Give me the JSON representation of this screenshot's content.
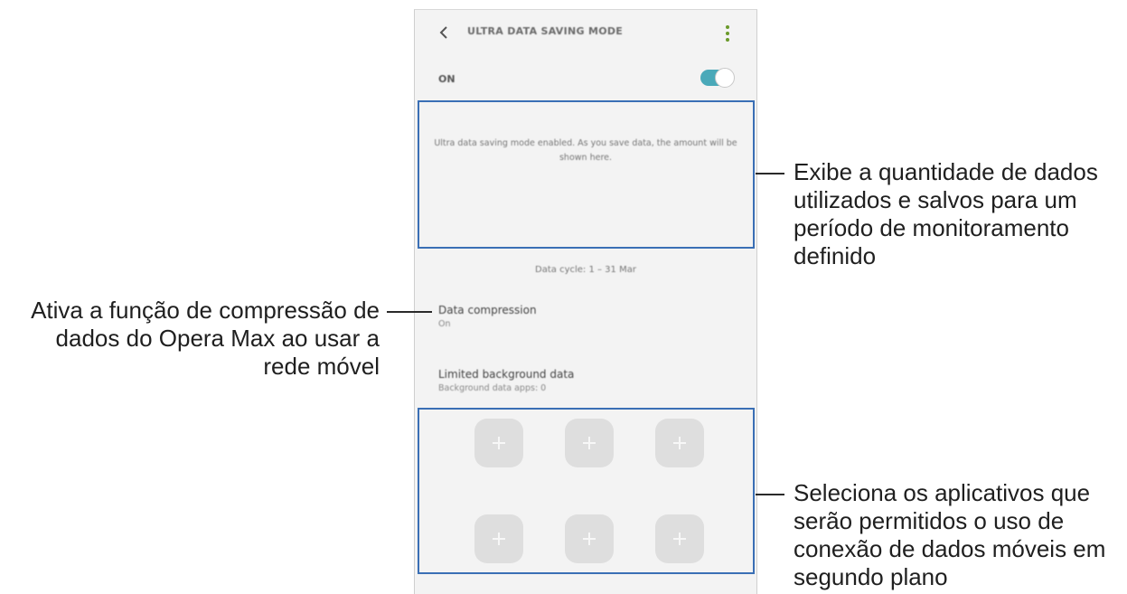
{
  "phone": {
    "title": "ULTRA DATA SAVING MODE",
    "on_label": "ON",
    "toggle_on": true,
    "accent_color": "#4aa9b9",
    "message": "Ultra data saving mode enabled. As you save data, the amount will be shown here.",
    "data_cycle": "Data cycle: 1 – 31 Mar",
    "settings": [
      {
        "title": "Data compression",
        "subtitle": "On"
      },
      {
        "title": "Limited background data",
        "subtitle": "Background data apps: 0"
      }
    ],
    "add_slots": [
      "add-icon",
      "add-icon",
      "add-icon",
      "add-icon",
      "add-icon",
      "add-icon"
    ],
    "icons": {
      "back": "back-arrow-icon",
      "more": "more-vert-icon"
    }
  },
  "callouts": {
    "usage": "Exibe a quantidade de dados utilizados e salvos para um período de monitoramento definido",
    "compression": "Ativa a função de compressão de dados do Opera Max ao usar a rede móvel",
    "apps": "Seleciona os aplicativos que serão permitidos o uso de conexão de dados móveis em segundo plano"
  },
  "colors": {
    "highlight": "#3a6fb5"
  }
}
